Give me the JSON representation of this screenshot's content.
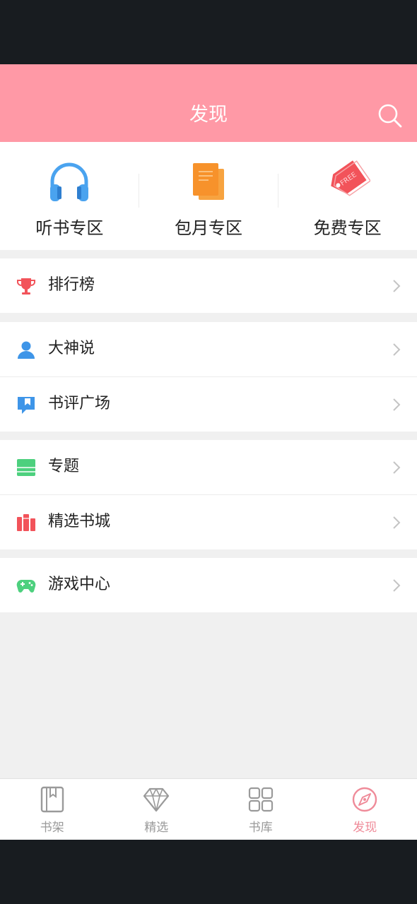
{
  "header": {
    "title": "发现",
    "icon": "search-icon"
  },
  "zones": [
    {
      "label": "听书专区",
      "icon": "headphones-icon",
      "color": "#4aa3ef"
    },
    {
      "label": "包月专区",
      "icon": "book-stack-icon",
      "color": "#f7922b"
    },
    {
      "label": "免费专区",
      "icon": "free-tag-icon",
      "color": "#f2535a",
      "tag_text": "FREE"
    }
  ],
  "groups": [
    {
      "items": [
        {
          "label": "排行榜",
          "icon": "trophy-icon",
          "color": "#f2535a"
        }
      ]
    },
    {
      "items": [
        {
          "label": "大神说",
          "icon": "user-icon",
          "color": "#3e95e8"
        },
        {
          "label": "书评广场",
          "icon": "book-review-icon",
          "color": "#3e95e8"
        }
      ]
    },
    {
      "items": [
        {
          "label": "专题",
          "icon": "topic-icon",
          "color": "#4dd07e"
        },
        {
          "label": "精选书城",
          "icon": "bookshelf-icon",
          "color": "#f2535a"
        }
      ]
    },
    {
      "items": [
        {
          "label": "游戏中心",
          "icon": "gamepad-icon",
          "color": "#4dd07e"
        }
      ]
    }
  ],
  "tabbar": [
    {
      "label": "书架",
      "icon": "bookshelf-tab-icon",
      "active": false
    },
    {
      "label": "精选",
      "icon": "diamond-icon",
      "active": false
    },
    {
      "label": "书库",
      "icon": "grid-icon",
      "active": false
    },
    {
      "label": "发现",
      "icon": "compass-icon",
      "active": true
    }
  ],
  "colors": {
    "header": "#ff99a6",
    "active_tab": "#ef8b99",
    "inactive_tab": "#9a9a9a"
  }
}
